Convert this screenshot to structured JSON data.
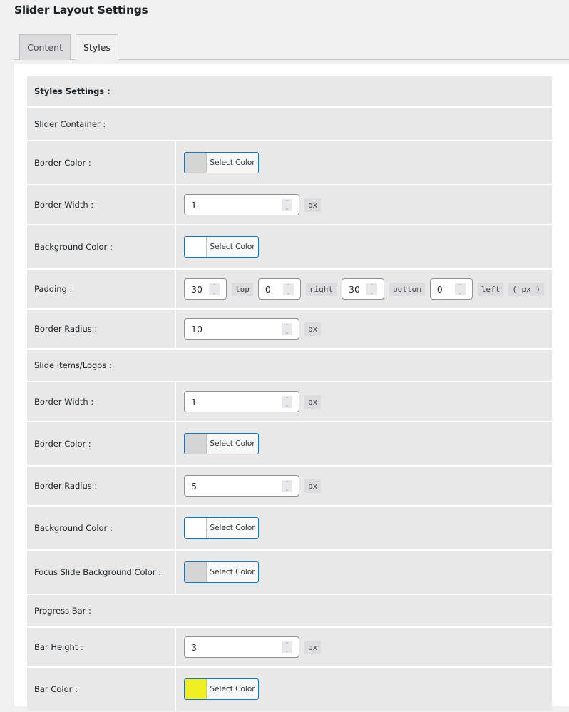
{
  "title": "Slider Layout Settings",
  "tabs": [
    {
      "label": "Content",
      "active": false
    },
    {
      "label": "Styles",
      "active": true
    }
  ],
  "rows": [
    {
      "type": "header",
      "label": "Styles Settings :",
      "bold": true,
      "h": 42
    },
    {
      "type": "section",
      "label": "Slider Container :",
      "h": 45
    },
    {
      "type": "color",
      "label": "Border Color :",
      "button": "Select Color",
      "swatch": "#d5d5d5",
      "h": 60
    },
    {
      "type": "number",
      "label": "Border Width :",
      "value": "1",
      "unit": "px",
      "h": 54
    },
    {
      "type": "color",
      "label": "Background Color :",
      "button": "Select Color",
      "swatch": "#ffffff",
      "h": 60
    },
    {
      "type": "padding",
      "label": "Padding :",
      "fields": [
        {
          "value": "30",
          "unit": "top"
        },
        {
          "value": "0",
          "unit": "right"
        },
        {
          "value": "30",
          "unit": "bottom"
        },
        {
          "value": "0",
          "unit": "left"
        }
      ],
      "suffix": "( px )",
      "h": 54
    },
    {
      "type": "number",
      "label": "Border Radius :",
      "value": "10",
      "unit": "px",
      "h": 54
    },
    {
      "type": "section",
      "label": "Slide Items/Logos :",
      "h": 44
    },
    {
      "type": "number",
      "label": "Border Width :",
      "value": "1",
      "unit": "px",
      "h": 54
    },
    {
      "type": "color",
      "label": "Border Color :",
      "button": "Select Color",
      "swatch": "#d5d5d5",
      "h": 60
    },
    {
      "type": "number",
      "label": "Border Radius :",
      "value": "5",
      "unit": "px",
      "h": 54
    },
    {
      "type": "color",
      "label": "Background Color :",
      "button": "Select Color",
      "swatch": "#ffffff",
      "h": 60
    },
    {
      "type": "color",
      "label": "Focus Slide Background Color :",
      "button": "Select Color",
      "swatch": "#d5d5d5",
      "h": 60
    },
    {
      "type": "section",
      "label": "Progress Bar :",
      "h": 44
    },
    {
      "type": "number",
      "label": "Bar Height :",
      "value": "3",
      "unit": "px",
      "h": 54
    },
    {
      "type": "color",
      "label": "Bar Color :",
      "button": "Select Color",
      "swatch": "#eeee22",
      "h": 60
    }
  ]
}
